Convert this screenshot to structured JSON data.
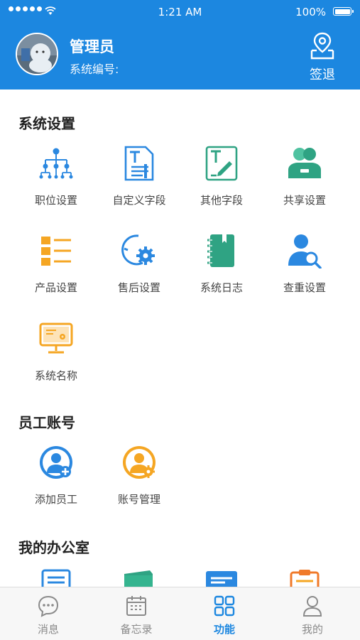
{
  "status_bar": {
    "time": "1:21 AM",
    "battery": "100%"
  },
  "header": {
    "user_name": "管理员",
    "system_id_label": "系统编号:",
    "signout_label": "签退"
  },
  "sections": {
    "system_settings": {
      "title": "系统设置",
      "items": [
        {
          "label": "职位设置",
          "icon": "org-chart-icon"
        },
        {
          "label": "自定义字段",
          "icon": "custom-text-doc-icon"
        },
        {
          "label": "其他字段",
          "icon": "edit-text-icon"
        },
        {
          "label": "共享设置",
          "icon": "share-users-icon"
        },
        {
          "label": "产品设置",
          "icon": "product-list-icon"
        },
        {
          "label": "售后设置",
          "icon": "after-sales-gear-icon"
        },
        {
          "label": "系统日志",
          "icon": "notebook-icon"
        },
        {
          "label": "查重设置",
          "icon": "user-search-icon"
        },
        {
          "label": "系统名称",
          "icon": "monitor-gear-icon"
        }
      ]
    },
    "staff_accounts": {
      "title": "员工账号",
      "items": [
        {
          "label": "添加员工",
          "icon": "add-user-icon"
        },
        {
          "label": "账号管理",
          "icon": "user-gear-icon"
        }
      ]
    },
    "my_office": {
      "title": "我的办公室",
      "items": [
        {
          "icon": "doc-icon"
        },
        {
          "icon": "folder-icon"
        },
        {
          "icon": "card-icon"
        },
        {
          "icon": "clipboard-icon"
        }
      ]
    }
  },
  "tabbar": {
    "tabs": [
      {
        "label": "消息",
        "icon": "chat-icon",
        "active": false
      },
      {
        "label": "备忘录",
        "icon": "calendar-icon",
        "active": false
      },
      {
        "label": "功能",
        "icon": "grid-icon",
        "active": true
      },
      {
        "label": "我的",
        "icon": "person-icon",
        "active": false
      }
    ]
  },
  "colors": {
    "primary": "#1c87e0",
    "accent_orange": "#f5a623",
    "accent_teal": "#2fa383"
  }
}
